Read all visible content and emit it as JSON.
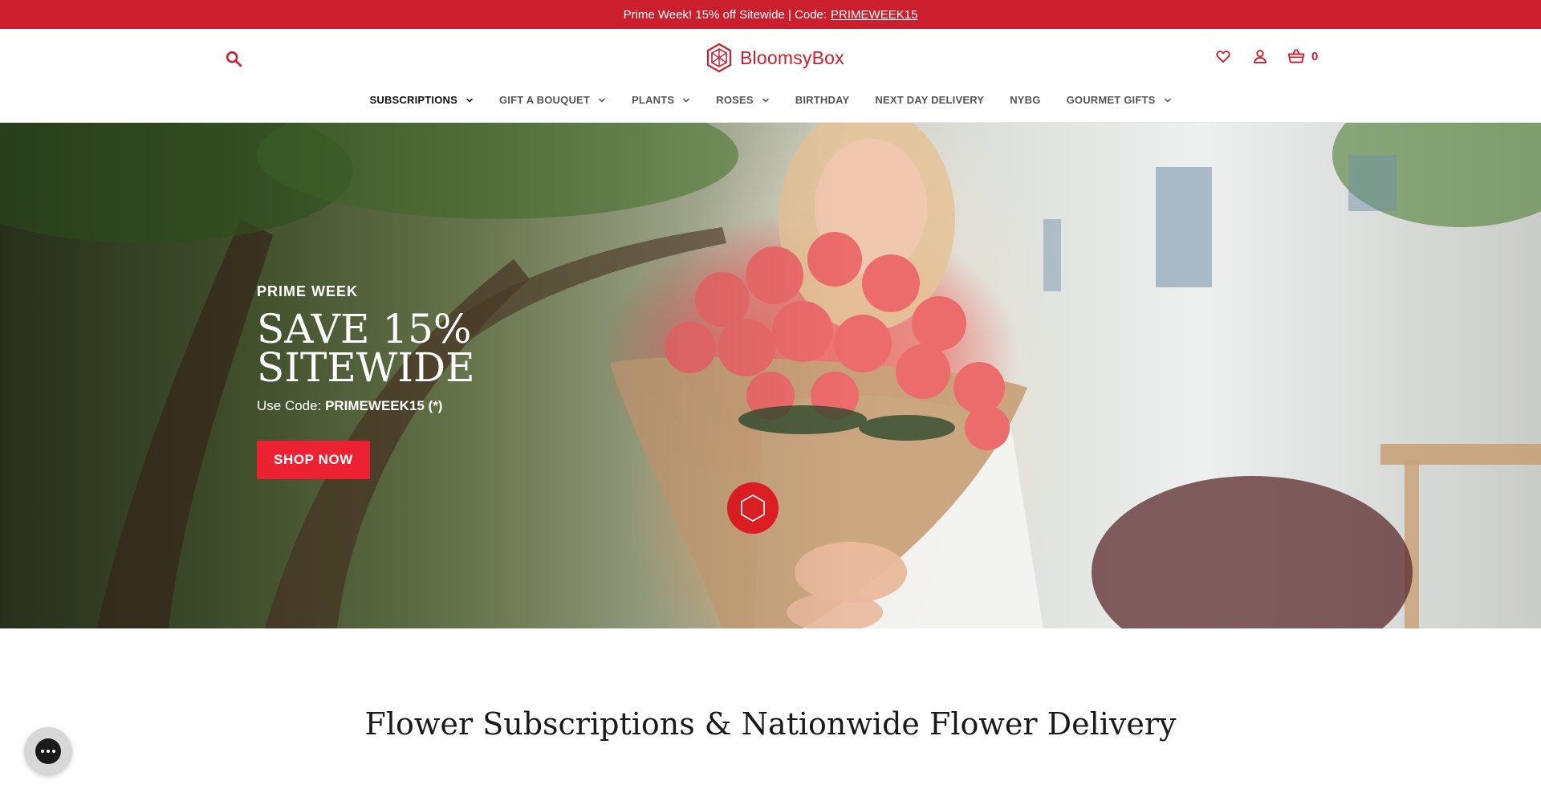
{
  "announcement": {
    "text": "Prime Week! 15% off Sitewide | Code:",
    "code": "PRIMEWEEK15"
  },
  "header": {
    "logo_text": "BloomsyBox",
    "cart_count": "0"
  },
  "nav": {
    "items": [
      {
        "label": "SUBSCRIPTIONS",
        "dropdown": true
      },
      {
        "label": "GIFT A BOUQUET",
        "dropdown": true
      },
      {
        "label": "PLANTS",
        "dropdown": true
      },
      {
        "label": "ROSES",
        "dropdown": true
      },
      {
        "label": "BIRTHDAY",
        "dropdown": false
      },
      {
        "label": "NEXT DAY DELIVERY",
        "dropdown": false
      },
      {
        "label": "NYBG",
        "dropdown": false
      },
      {
        "label": "GOURMET GIFTS",
        "dropdown": true
      }
    ]
  },
  "hero": {
    "eyebrow": "PRIME WEEK",
    "title_line1": "SAVE 15%",
    "title_line2": "SITEWIDE",
    "code_prefix": "Use Code:",
    "code": "PRIMEWEEK15 (*)",
    "cta": "SHOP NOW"
  },
  "section": {
    "title": "Flower Subscriptions & Nationwide Flower Delivery"
  },
  "colors": {
    "brand_red": "#cc1f2e",
    "cta_red": "#ec2233"
  },
  "icons": {
    "search": "search-icon",
    "wishlist": "heart-icon",
    "account": "user-icon",
    "cart": "basket-icon",
    "chat": "chat-icon"
  }
}
